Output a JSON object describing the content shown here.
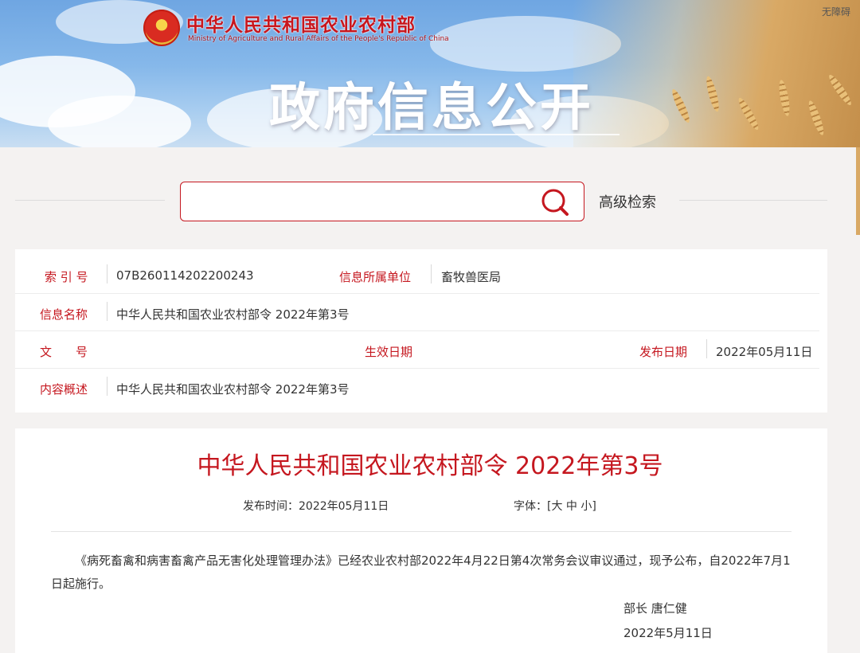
{
  "header": {
    "ministry_cn": "中华人民共和国农业农村部",
    "ministry_en": "Ministry of Agriculture and Rural Affairs of the People's Republic of China",
    "accessibility": "无障碍",
    "banner_title": "政府信息公开",
    "emblem_icon": "national-emblem-icon"
  },
  "search": {
    "value": "",
    "placeholder": "",
    "advanced_label": "高级检索",
    "icon": "search-icon"
  },
  "info": {
    "index_label": "索 引 号",
    "index_value": "07B260114202200243",
    "unit_label": "信息所属单位",
    "unit_value": "畜牧兽医局",
    "name_label": "信息名称",
    "name_value": "中华人民共和国农业农村部令 2022年第3号",
    "doc_label": "文　　号",
    "effective_label": "生效日期",
    "publish_label": "发布日期",
    "publish_value": "2022年05月11日",
    "summary_label": "内容概述",
    "summary_value": "中华人民共和国农业农村部令 2022年第3号"
  },
  "article": {
    "title": "中华人民共和国农业农村部令 2022年第3号",
    "publish_time_label": "发布时间：",
    "publish_time_value": "2022年05月11日",
    "font_label": "字体：",
    "font_bracket_open": "[",
    "font_large": "大",
    "font_medium": "中",
    "font_small": "小",
    "font_bracket_close": "]",
    "body": "《病死畜禽和病害畜禽产品无害化处理管理办法》已经农业农村部2022年4月22日第4次常务会议审议通过，现予公布，自2022年7月1日起施行。",
    "signer": "部长  唐仁健",
    "sign_date": "2022年5月11日"
  },
  "colors": {
    "accent_red": "#c5171f",
    "sky_blue": "#86b8ea",
    "page_bg": "#f4f2f1"
  }
}
